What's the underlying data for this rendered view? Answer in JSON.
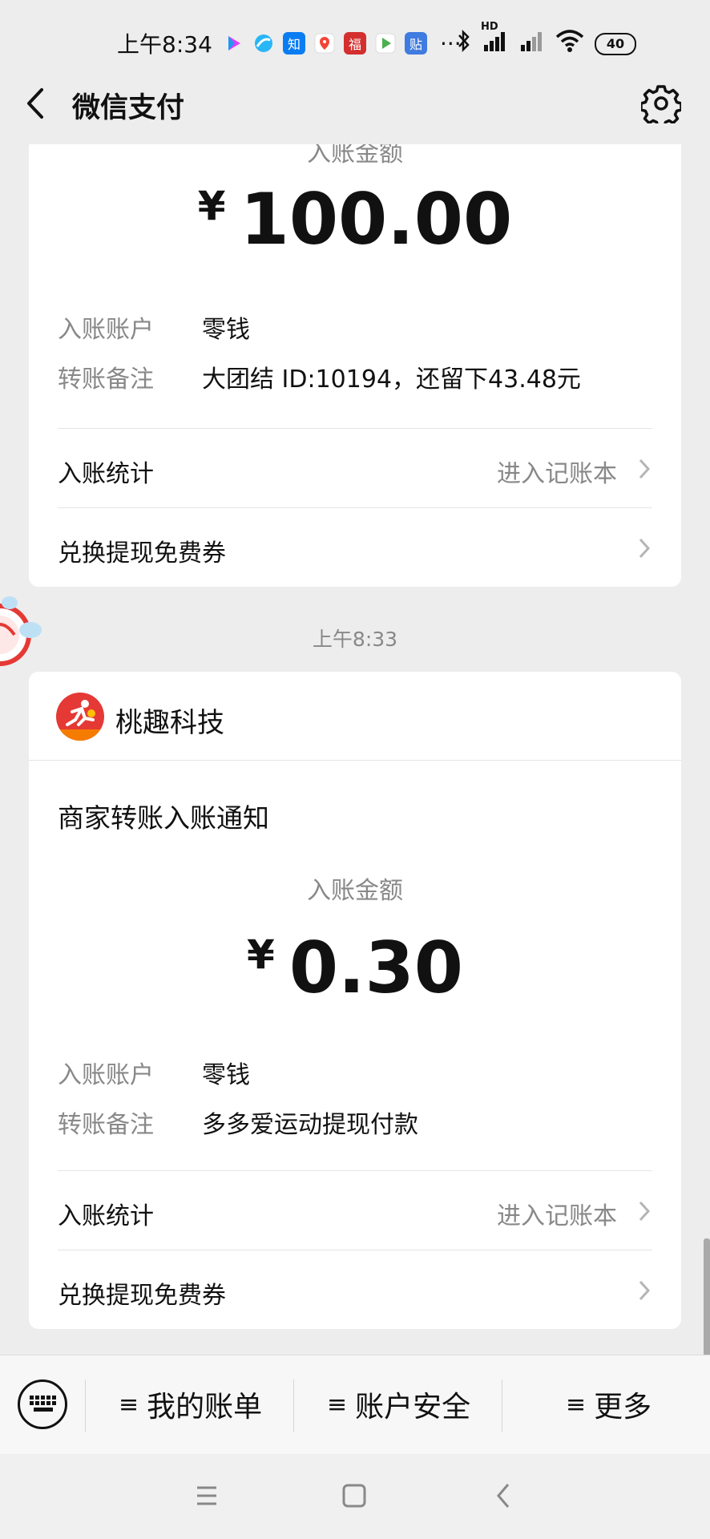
{
  "status_bar": {
    "time": "上午8:34",
    "app_icons": [
      "video-app-icon",
      "browser-icon",
      "zhihu-icon",
      "maps-icon",
      "fu-icon",
      "play-icon",
      "tieba-icon"
    ],
    "app_icon_text": {
      "zhihu": "知",
      "fu": "福",
      "tieba": "贴"
    },
    "more": "···",
    "network": "HD",
    "battery": "40"
  },
  "nav": {
    "title": "微信支付"
  },
  "card1": {
    "amount_label": "入账金额",
    "currency": "¥",
    "amount": "100.00",
    "account_key": "入账账户",
    "account_value": "零钱",
    "remark_key": "转账备注",
    "remark_value": "大团结 ID:10194，还留下43.48元",
    "stats_label": "入账统计",
    "stats_link": "进入记账本",
    "coupon_label": "兑换提现免费券"
  },
  "timestamp": "上午8:33",
  "card2": {
    "merchant_name": "桃趣科技",
    "notice_title": "商家转账入账通知",
    "amount_label": "入账金额",
    "currency": "¥",
    "amount": "0.30",
    "account_key": "入账账户",
    "account_value": "零钱",
    "remark_key": "转账备注",
    "remark_value": "多多爱运动提现付款",
    "stats_label": "入账统计",
    "stats_link": "进入记账本",
    "coupon_label": "兑换提现免费券"
  },
  "bottom_menu": {
    "items": [
      {
        "label": "我的账单"
      },
      {
        "label": "账户安全"
      },
      {
        "label": "更多"
      }
    ],
    "menu_glyph": "≡"
  },
  "colors": {
    "background": "#ededed",
    "card": "#ffffff",
    "secondary_text": "#888888",
    "merchant_logo": "#e53935"
  }
}
